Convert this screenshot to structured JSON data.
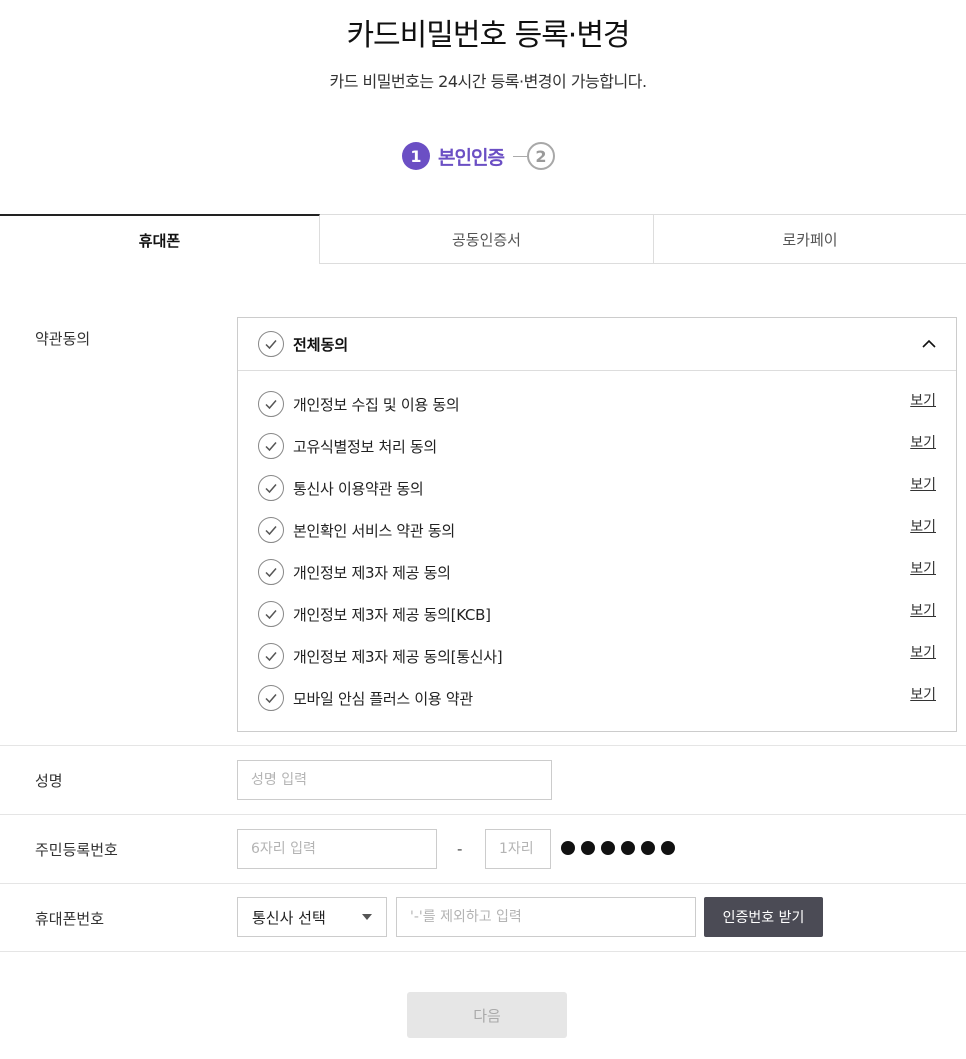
{
  "header": {
    "title": "카드비밀번호 등록·변경",
    "subtitle": "카드 비밀번호는 24시간 등록·변경이 가능합니다."
  },
  "steps": {
    "step1_number": "1",
    "step1_label": "본인인증",
    "step2_number": "2"
  },
  "tabs": [
    {
      "label": "휴대폰"
    },
    {
      "label": "공동인증서"
    },
    {
      "label": "로카페이"
    }
  ],
  "terms": {
    "section_label": "약관동의",
    "all_agree_label": "전체동의",
    "view_label": "보기",
    "items": [
      {
        "label": "개인정보 수집 및 이용 동의"
      },
      {
        "label": "고유식별정보 처리 동의"
      },
      {
        "label": "통신사 이용약관 동의"
      },
      {
        "label": "본인확인 서비스 약관 동의"
      },
      {
        "label": "개인정보 제3자 제공 동의"
      },
      {
        "label": "개인정보 제3자 제공 동의[KCB]"
      },
      {
        "label": "개인정보 제3자 제공 동의[통신사]"
      },
      {
        "label": "모바일 안심 플러스 이용 약관"
      }
    ]
  },
  "form": {
    "name_label": "성명",
    "name_placeholder": "성명 입력",
    "rrn_label": "주민등록번호",
    "rrn_front_placeholder": "6자리 입력",
    "rrn_separator": "-",
    "rrn_back_placeholder": "1자리",
    "phone_label": "휴대폰번호",
    "carrier_select": "통신사 선택",
    "phone_placeholder": "'-'를 제외하고 입력",
    "auth_button": "인증번호 받기"
  },
  "next_button": "다음",
  "colors": {
    "accent": "#6b4fc4",
    "auth_button_bg": "#4b4b55",
    "disabled_bg": "#e6e6e6"
  }
}
